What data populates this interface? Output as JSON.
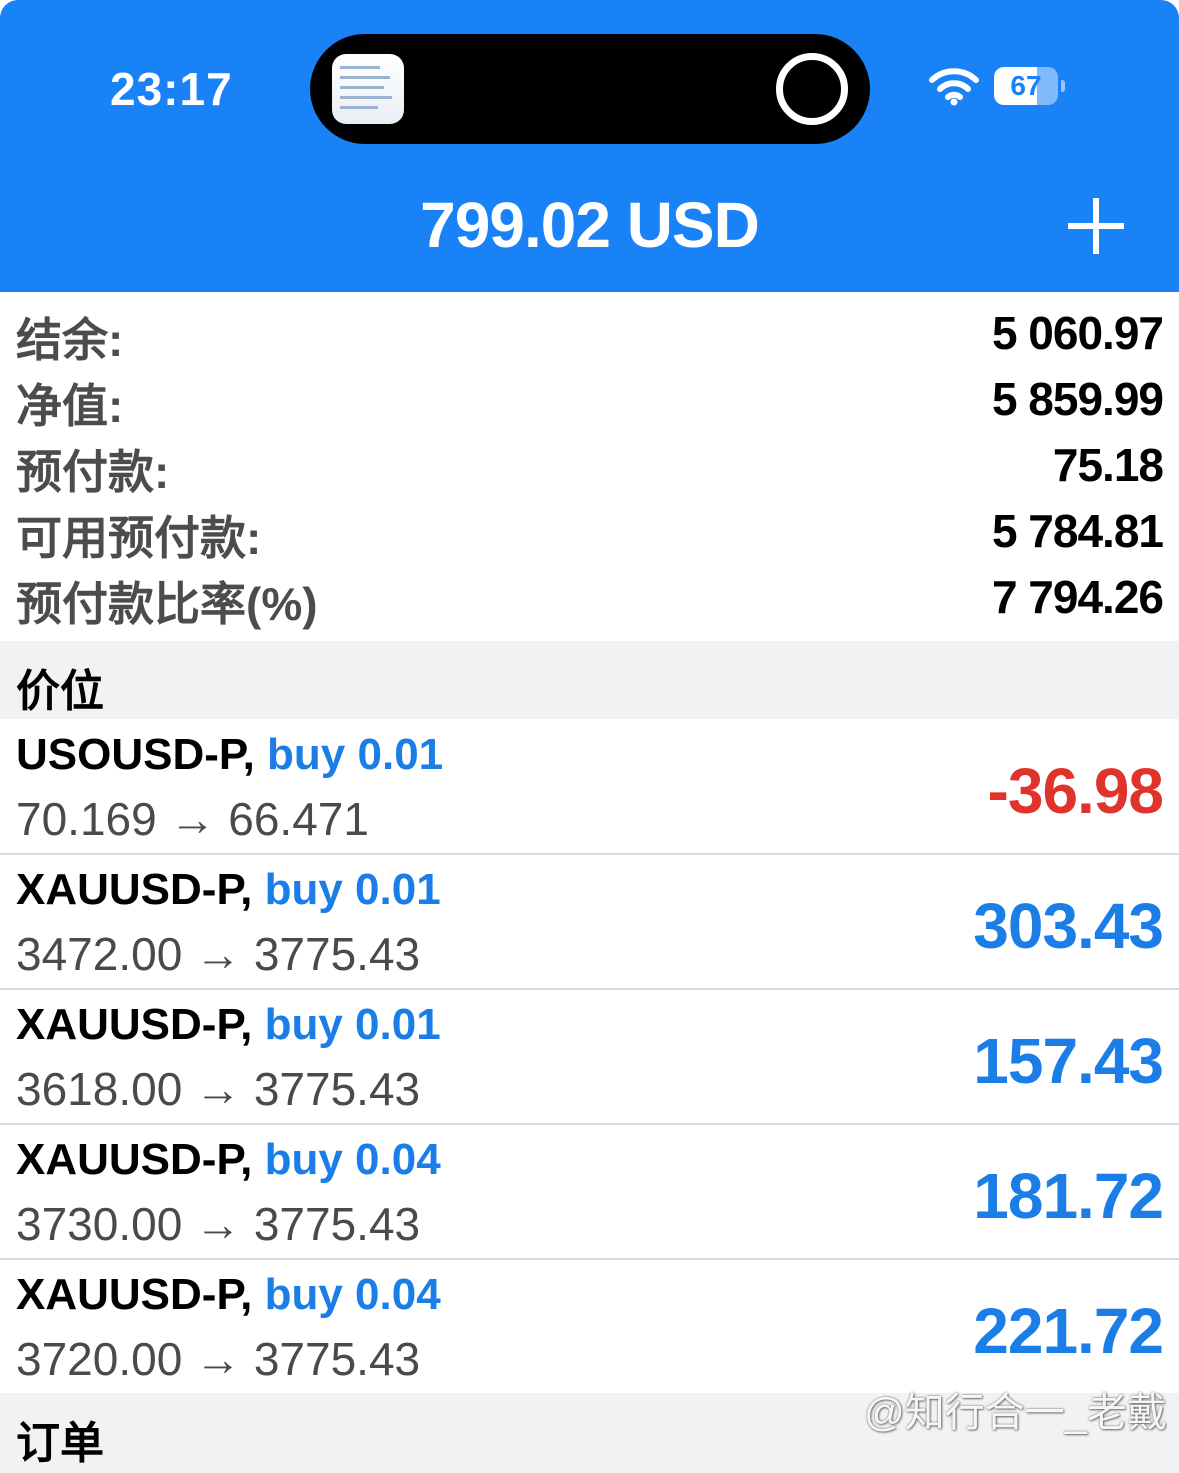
{
  "status_bar": {
    "time": "23:17",
    "battery_level": "67",
    "battery_fraction": 0.67
  },
  "header": {
    "title": "799.02 USD"
  },
  "account": [
    {
      "label": "结余:",
      "value": "5 060.97"
    },
    {
      "label": "净值:",
      "value": "5 859.99"
    },
    {
      "label": "预付款:",
      "value": "75.18"
    },
    {
      "label": "可用预付款:",
      "value": "5 784.81"
    },
    {
      "label": "预付款比率(%)",
      "value": "7 794.26"
    }
  ],
  "sections": {
    "positions_title": "价位",
    "orders_title": "订单"
  },
  "positions": [
    {
      "symbol": "USOUSD-P,",
      "side": "buy 0.01",
      "prices": "70.169 → 66.471",
      "profit": "-36.98",
      "profit_color": "#e0332b"
    },
    {
      "symbol": "XAUUSD-P,",
      "side": "buy 0.01",
      "prices": "3472.00 → 3775.43",
      "profit": "303.43",
      "profit_color": "#1a7ee6"
    },
    {
      "symbol": "XAUUSD-P,",
      "side": "buy 0.01",
      "prices": "3618.00 → 3775.43",
      "profit": "157.43",
      "profit_color": "#1a7ee6"
    },
    {
      "symbol": "XAUUSD-P,",
      "side": "buy 0.04",
      "prices": "3730.00 → 3775.43",
      "profit": "181.72",
      "profit_color": "#1a7ee6"
    },
    {
      "symbol": "XAUUSD-P,",
      "side": "buy 0.04",
      "prices": "3720.00 → 3775.43",
      "profit": "221.72",
      "profit_color": "#1a7ee6"
    }
  ],
  "watermark": "@知行合一_老戴",
  "colors": {
    "header_blue": "#1a82f7",
    "buy_blue": "#1a7ee6",
    "loss_red": "#e0332b"
  }
}
